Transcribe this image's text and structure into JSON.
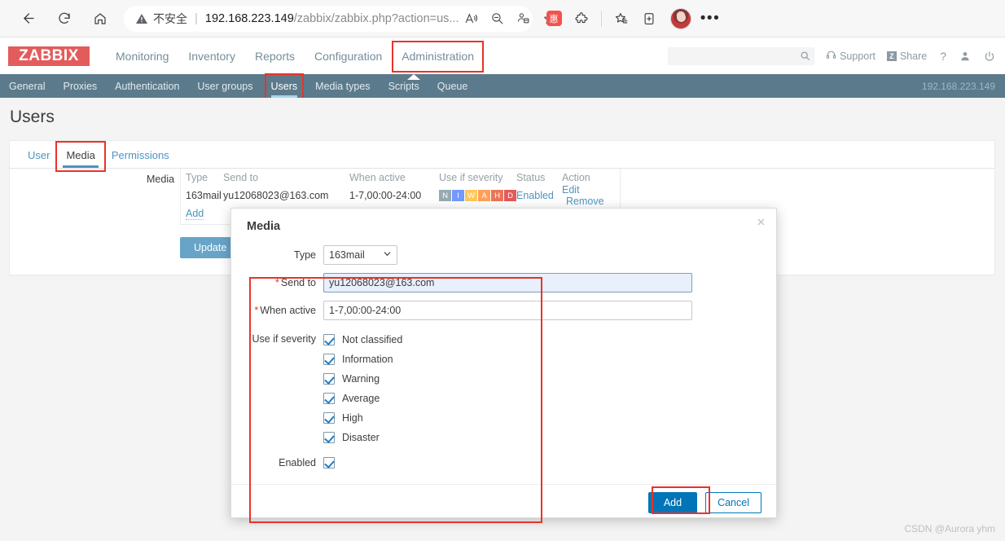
{
  "browser": {
    "back_icon": "back-arrow-icon",
    "reload_icon": "reload-icon",
    "home_icon": "home-icon",
    "security_label": "不安全",
    "url_host": "192.168.223.149",
    "url_path": "/zabbix/zabbix.php?action=us...",
    "read_aloud_icon": "read-aloud-icon",
    "zoom_out_icon": "zoom-out-icon",
    "collections_icon": "split-screen-icon",
    "favorite_icon": "add-favorite-icon",
    "extension_badge": "惠",
    "extensions_icon": "extensions-icon",
    "favorites_icon": "favorites-icon",
    "collections_panel_icon": "collections-icon",
    "avatar_label": "profile-avatar",
    "more_icon": "more-options-icon"
  },
  "zabbix_header": {
    "logo": "ZABBIX",
    "menu": [
      {
        "label": "Monitoring",
        "highlighted": false
      },
      {
        "label": "Inventory",
        "highlighted": false
      },
      {
        "label": "Reports",
        "highlighted": false
      },
      {
        "label": "Configuration",
        "highlighted": false
      },
      {
        "label": "Administration",
        "highlighted": true
      }
    ],
    "search_placeholder": "",
    "search_value": "",
    "support_label": "Support",
    "share_label": "Share",
    "share_badge": "Z",
    "help_label": "?",
    "user_icon": "user-icon",
    "signout_icon": "power-icon"
  },
  "subnav": {
    "items": [
      {
        "label": "General",
        "active": false,
        "highlighted": false
      },
      {
        "label": "Proxies",
        "active": false,
        "highlighted": false
      },
      {
        "label": "Authentication",
        "active": false,
        "highlighted": false
      },
      {
        "label": "User groups",
        "active": false,
        "highlighted": false
      },
      {
        "label": "Users",
        "active": true,
        "highlighted": true
      },
      {
        "label": "Media types",
        "active": false,
        "highlighted": false
      },
      {
        "label": "Scripts",
        "active": false,
        "highlighted": false
      },
      {
        "label": "Queue",
        "active": false,
        "highlighted": false
      }
    ],
    "server_ip": "192.168.223.149"
  },
  "page": {
    "title": "Users",
    "tabs": [
      {
        "label": "User",
        "active": false,
        "highlighted": false
      },
      {
        "label": "Media",
        "active": true,
        "highlighted": true
      },
      {
        "label": "Permissions",
        "active": false,
        "highlighted": false
      }
    ],
    "media_field_label": "Media",
    "media_table": {
      "headers": [
        "Type",
        "Send to",
        "When active",
        "Use if severity",
        "Status",
        "Action"
      ],
      "rows": [
        {
          "type": "163mail",
          "send_to": "yu12068023@163.com",
          "when_active": "1-7,00:00-24:00",
          "severities": [
            {
              "letter": "N",
              "color": "#97aab3"
            },
            {
              "letter": "I",
              "color": "#7499ff"
            },
            {
              "letter": "W",
              "color": "#ffc859"
            },
            {
              "letter": "A",
              "color": "#ffa059"
            },
            {
              "letter": "H",
              "color": "#e97659"
            },
            {
              "letter": "D",
              "color": "#e45959"
            }
          ],
          "status": "Enabled",
          "actions": [
            "Edit",
            "Remove"
          ]
        }
      ],
      "add_label": "Add"
    },
    "update_label": "Update"
  },
  "modal": {
    "title": "Media",
    "close_icon": "close-icon",
    "type_label": "Type",
    "type_value": "163mail",
    "send_to_label": "Send to",
    "send_to_value": "yu12068023@163.com",
    "send_to_required": "*",
    "when_active_label": "When active",
    "when_active_value": "1-7,00:00-24:00",
    "when_active_required": "*",
    "severity_label": "Use if severity",
    "severities": [
      {
        "label": "Not classified",
        "checked": true
      },
      {
        "label": "Information",
        "checked": true
      },
      {
        "label": "Warning",
        "checked": true
      },
      {
        "label": "Average",
        "checked": true
      },
      {
        "label": "High",
        "checked": true
      },
      {
        "label": "Disaster",
        "checked": true
      }
    ],
    "enabled_label": "Enabled",
    "enabled_checked": true,
    "add_label": "Add",
    "cancel_label": "Cancel"
  },
  "watermark": "CSDN @Aurora yhm",
  "colors": {
    "highlight": "#e8332a",
    "zabbix_red": "#e35c5c",
    "subnav_bg": "#5b7b8c",
    "link": "#4f94bf",
    "primary_button": "#0275b8"
  }
}
